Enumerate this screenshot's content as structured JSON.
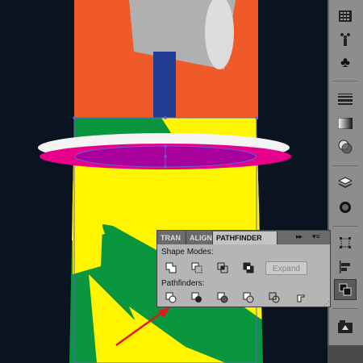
{
  "panel": {
    "tabs": [
      {
        "label": "TRAN",
        "active": false
      },
      {
        "label": "ALIGN",
        "active": false
      },
      {
        "label": "PATHFINDER",
        "active": true
      }
    ],
    "collapse_glyph": "▸▸",
    "menu_glyph": "▾≡",
    "shape_modes_label": "Shape Modes:",
    "pathfinders_label": "Pathfinders:",
    "expand_label": "Expand",
    "shape_mode_icons": [
      "unite-icon",
      "minus-front-icon",
      "intersect-icon",
      "exclude-icon"
    ],
    "pathfinder_icons": [
      "divide-icon",
      "trim-icon",
      "merge-icon",
      "crop-icon",
      "outline-icon",
      "minus-back-icon"
    ]
  },
  "toolstrip": {
    "icons": [
      "swatch-grid-icon",
      "symbol-sprayer-icon",
      "club-symbol-icon",
      "stroke-icon",
      "gradient-icon",
      "transparency-icon",
      "layers-icon",
      "appearance-icon",
      "transform-icon",
      "align-icon",
      "pathfinder-icon",
      "graphic-styles-icon"
    ],
    "active_icon": "pathfinder-icon"
  },
  "colors": {
    "background": "#0a1420",
    "orange": "#f05a28",
    "blue": "#233c91",
    "green": "#0a963c",
    "yellow": "#fff500",
    "magenta": "#e6008c",
    "selection": "#6a5bd8",
    "arrow": "#e01818"
  }
}
